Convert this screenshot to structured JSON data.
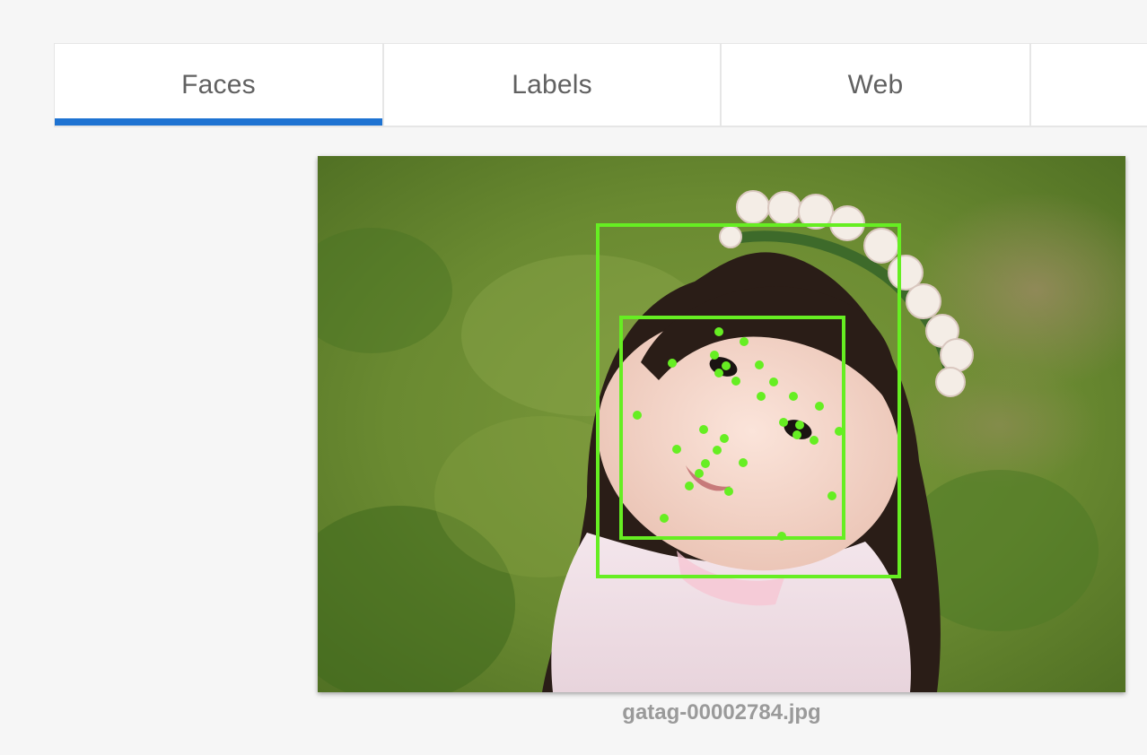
{
  "tabs": [
    {
      "label": "Faces",
      "active": true
    },
    {
      "label": "Labels",
      "active": false
    },
    {
      "label": "Web",
      "active": false
    },
    {
      "label": "",
      "active": false
    }
  ],
  "image": {
    "filename": "gatag-00002784.jpg",
    "overlay_color": "#66ee22"
  },
  "colors": {
    "accent": "#1e73d2",
    "tab_text": "#616161",
    "background": "#f6f6f6",
    "caption": "#9a9a9a"
  }
}
